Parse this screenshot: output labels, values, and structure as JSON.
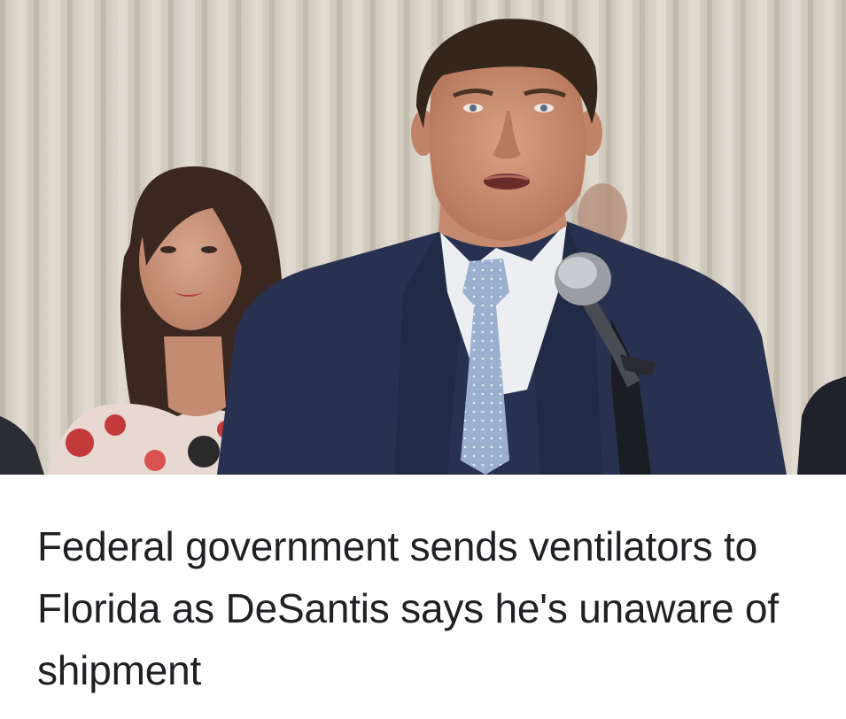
{
  "article": {
    "headline": "Federal government sends ventilators to Florida as DeSantis says he's unaware of shipment",
    "image": {
      "subject": "photo-speaker-at-podium",
      "colors": {
        "curtain": "#d8d1c8",
        "suit": "#2a3550",
        "shirt": "#eef0f2",
        "tie": "#8fa6c8",
        "skin": "#c98f74",
        "hair": "#3a2a1e"
      }
    }
  }
}
